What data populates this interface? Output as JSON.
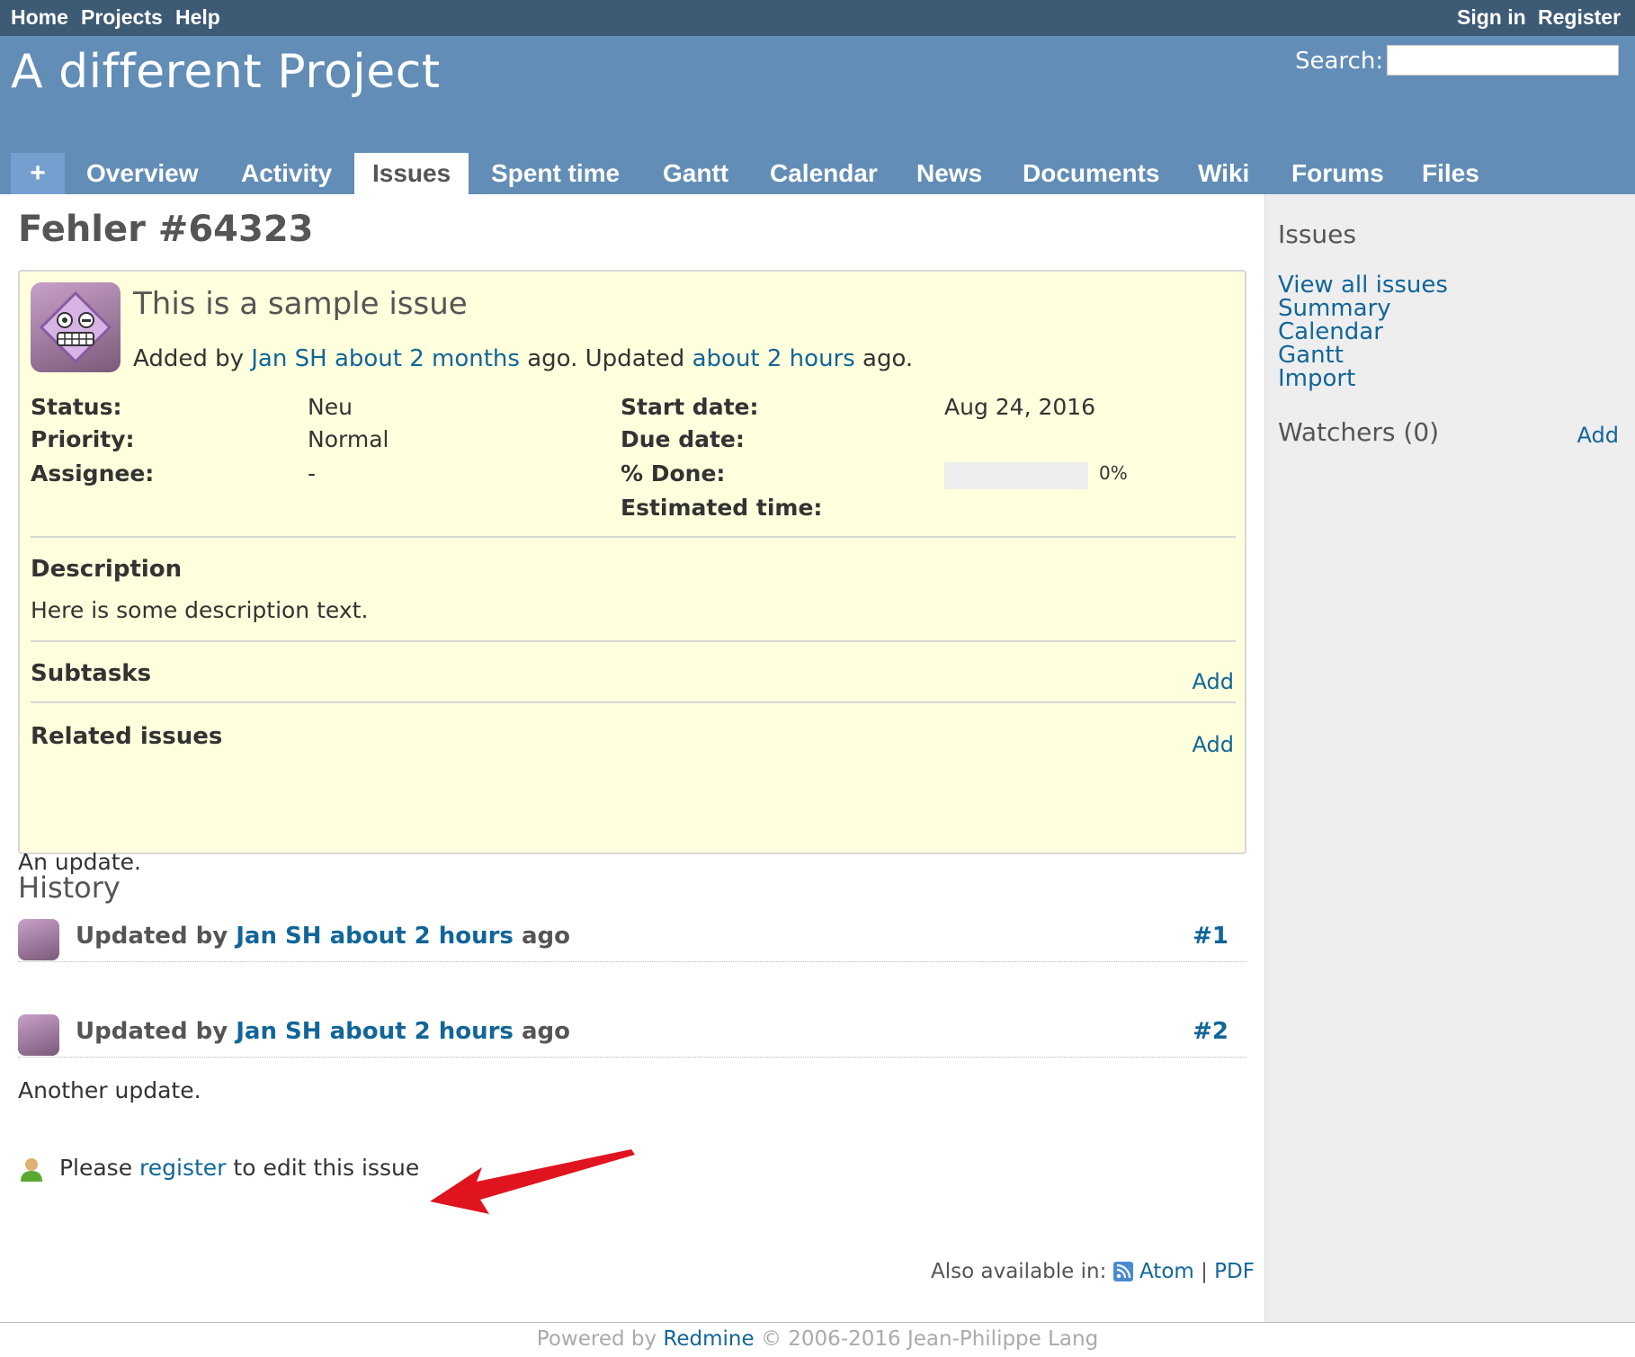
{
  "top_menu": {
    "home": "Home",
    "projects": "Projects",
    "help": "Help",
    "sign_in": "Sign in",
    "register": "Register"
  },
  "header": {
    "project_title": "A different Project",
    "search_label": "Search:",
    "search_value": ""
  },
  "main_menu": {
    "plus": "+",
    "tabs": [
      "Overview",
      "Activity",
      "Issues",
      "Spent time",
      "Gantt",
      "Calendar",
      "News",
      "Documents",
      "Wiki",
      "Forums",
      "Files"
    ],
    "selected": "Issues"
  },
  "issue": {
    "title": "Fehler #64323",
    "subject": "This is a sample issue",
    "added_by_prefix": "Added by",
    "author": "Jan SH",
    "added_ago": "about 2 months",
    "ago_updated": "ago. Updated",
    "updated_ago": "about 2 hours",
    "ago_end": "ago.",
    "attributes": {
      "status_label": "Status:",
      "status_value": "Neu",
      "priority_label": "Priority:",
      "priority_value": "Normal",
      "assignee_label": "Assignee:",
      "assignee_value": "-",
      "start_date_label": "Start date:",
      "start_date_value": "Aug 24, 2016",
      "due_date_label": "Due date:",
      "done_label": "% Done:",
      "done_value": "0%",
      "done_ratio": 0,
      "estimated_label": "Estimated time:"
    },
    "description_title": "Description",
    "description_text": "Here is some description text.",
    "subtasks_title": "Subtasks",
    "subtasks_add": "Add",
    "related_title": "Related issues",
    "related_add": "Add"
  },
  "history": {
    "title": "History",
    "journals": [
      {
        "prefix": "Updated by",
        "author": "Jan SH",
        "ago": "about 2 hours",
        "suffix": "ago",
        "number": "#1",
        "note": "An update."
      },
      {
        "prefix": "Updated by",
        "author": "Jan SH",
        "ago": "about 2 hours",
        "suffix": "ago",
        "number": "#2",
        "note": "Another update."
      }
    ]
  },
  "register_notice": {
    "prefix": "Please",
    "link": "register",
    "suffix": "to edit this issue"
  },
  "other_formats": {
    "label": "Also available in:",
    "atom": "Atom",
    "separator": "|",
    "pdf": "PDF"
  },
  "sidebar": {
    "issues_title": "Issues",
    "links": [
      "View all issues",
      "Summary",
      "Calendar",
      "Gantt",
      "Import"
    ],
    "watchers_title": "Watchers (0)",
    "watchers_add": "Add"
  },
  "footer": {
    "powered_by": "Powered by",
    "redmine": "Redmine",
    "copyright": "© 2006-2016 Jean-Philippe Lang"
  },
  "colors": {
    "top_menu_bg": "#3e5b76",
    "header_bg": "#628db6",
    "link": "#169",
    "issue_box_bg": "#ffffdd",
    "sidebar_bg": "#eeeeee",
    "annotation_arrow": "#e0141e"
  }
}
